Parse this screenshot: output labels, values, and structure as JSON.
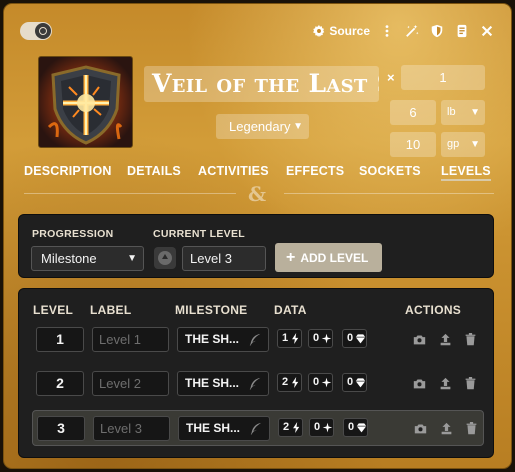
{
  "header": {
    "source_label": "Source",
    "icons": [
      "gear-icon",
      "ellipsis-vertical-icon",
      "magic-wand-icon",
      "shield-icon",
      "scroll-icon",
      "close-icon"
    ]
  },
  "item": {
    "name": "Veil of the Last Stand",
    "rarity": "Legendary",
    "quantity_symbol": "×",
    "quantity": "1",
    "weight": "6",
    "weight_unit": "lb",
    "price": "10",
    "price_unit": "gp"
  },
  "tabs": [
    {
      "label": "DESCRIPTION",
      "active": false
    },
    {
      "label": "DETAILS",
      "active": false
    },
    {
      "label": "ACTIVITIES",
      "active": false
    },
    {
      "label": "EFFECTS",
      "active": false
    },
    {
      "label": "SOCKETS",
      "active": false
    },
    {
      "label": "LEVELS",
      "active": true
    }
  ],
  "divider_glyph": "&",
  "progression": {
    "progression_label": "PROGRESSION",
    "progression_value": "Milestone",
    "current_level_label": "CURRENT LEVEL",
    "current_level_value": "Level 3",
    "add_level_label": "ADD LEVEL"
  },
  "levels_table": {
    "headers": {
      "level": "LEVEL",
      "label": "LABEL",
      "milestone": "MILESTONE",
      "data": "DATA",
      "actions": "ACTIONS"
    },
    "rows": [
      {
        "level": "1",
        "label_placeholder": "Level 1",
        "milestone": "THE SH...",
        "bolt": "1",
        "sparkle": "0",
        "gem": "0",
        "highlight": false
      },
      {
        "level": "2",
        "label_placeholder": "Level 2",
        "milestone": "THE SH...",
        "bolt": "2",
        "sparkle": "0",
        "gem": "0",
        "highlight": false
      },
      {
        "level": "3",
        "label_placeholder": "Level 3",
        "milestone": "THE SH...",
        "bolt": "2",
        "sparkle": "0",
        "gem": "0",
        "highlight": true
      }
    ],
    "action_icons": [
      "camera-icon",
      "upload-icon",
      "trash-icon"
    ]
  },
  "colors": {
    "accent": "#d29c38",
    "panel": "#1f1f1f",
    "add_button": "#b9b09c"
  }
}
